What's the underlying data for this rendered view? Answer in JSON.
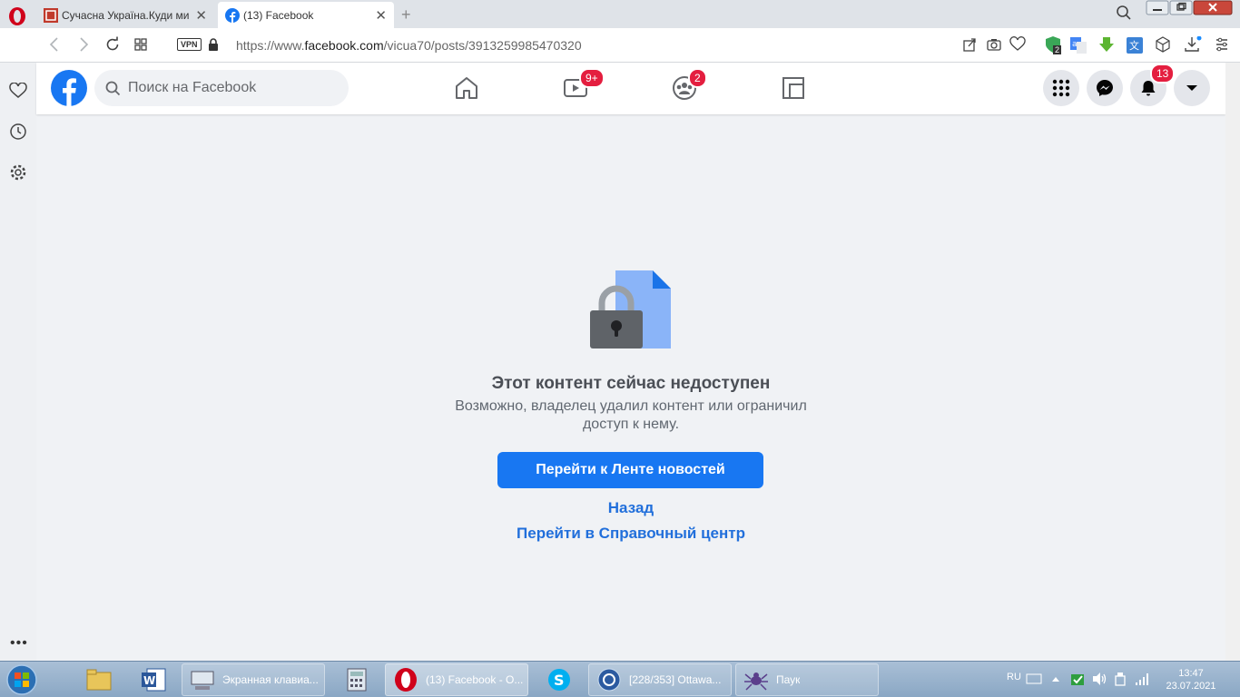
{
  "browser": {
    "tabs": [
      {
        "title": "Сучасна Україна.Куди ми",
        "active": false
      },
      {
        "title": "(13) Facebook",
        "active": true
      }
    ],
    "url_prefix": "https://www.",
    "url_domain": "facebook.com",
    "url_path": "/vicua70/posts/3913259985470320",
    "vpn_label": "VPN",
    "extension_badge": "2"
  },
  "facebook": {
    "search_placeholder": "Поиск на Facebook",
    "watch_badge": "9+",
    "groups_badge": "2",
    "notifications_badge": "13",
    "nav_icons": [
      "home-icon",
      "watch-icon",
      "groups-icon",
      "gaming-icon"
    ]
  },
  "content": {
    "title": "Этот контент сейчас недоступен",
    "body": "Возможно, владелец удалил контент или ограничил доступ к нему.",
    "primary_button": "Перейти к Ленте новостей",
    "back_link": "Назад",
    "help_link": "Перейти в Справочный центр"
  },
  "taskbar": {
    "items": [
      {
        "label": "",
        "icon": "file-explorer-icon"
      },
      {
        "label": "",
        "icon": "word-icon"
      },
      {
        "label": "Экранная клавиа...",
        "icon": "onscreen-keyboard-icon"
      },
      {
        "label": "",
        "icon": "calculator-icon"
      },
      {
        "label": "(13) Facebook - O...",
        "icon": "opera-icon"
      },
      {
        "label": "",
        "icon": "skype-icon"
      },
      {
        "label": "[228/353] Ottawa...",
        "icon": "viewer-icon"
      },
      {
        "label": "Паук",
        "icon": "spider-icon"
      }
    ],
    "language": "RU",
    "time": "13:47",
    "date": "23.07.2021"
  },
  "colors": {
    "fb_blue": "#1877f2",
    "badge_red": "#e41e3f",
    "link_blue": "#216fdb"
  }
}
